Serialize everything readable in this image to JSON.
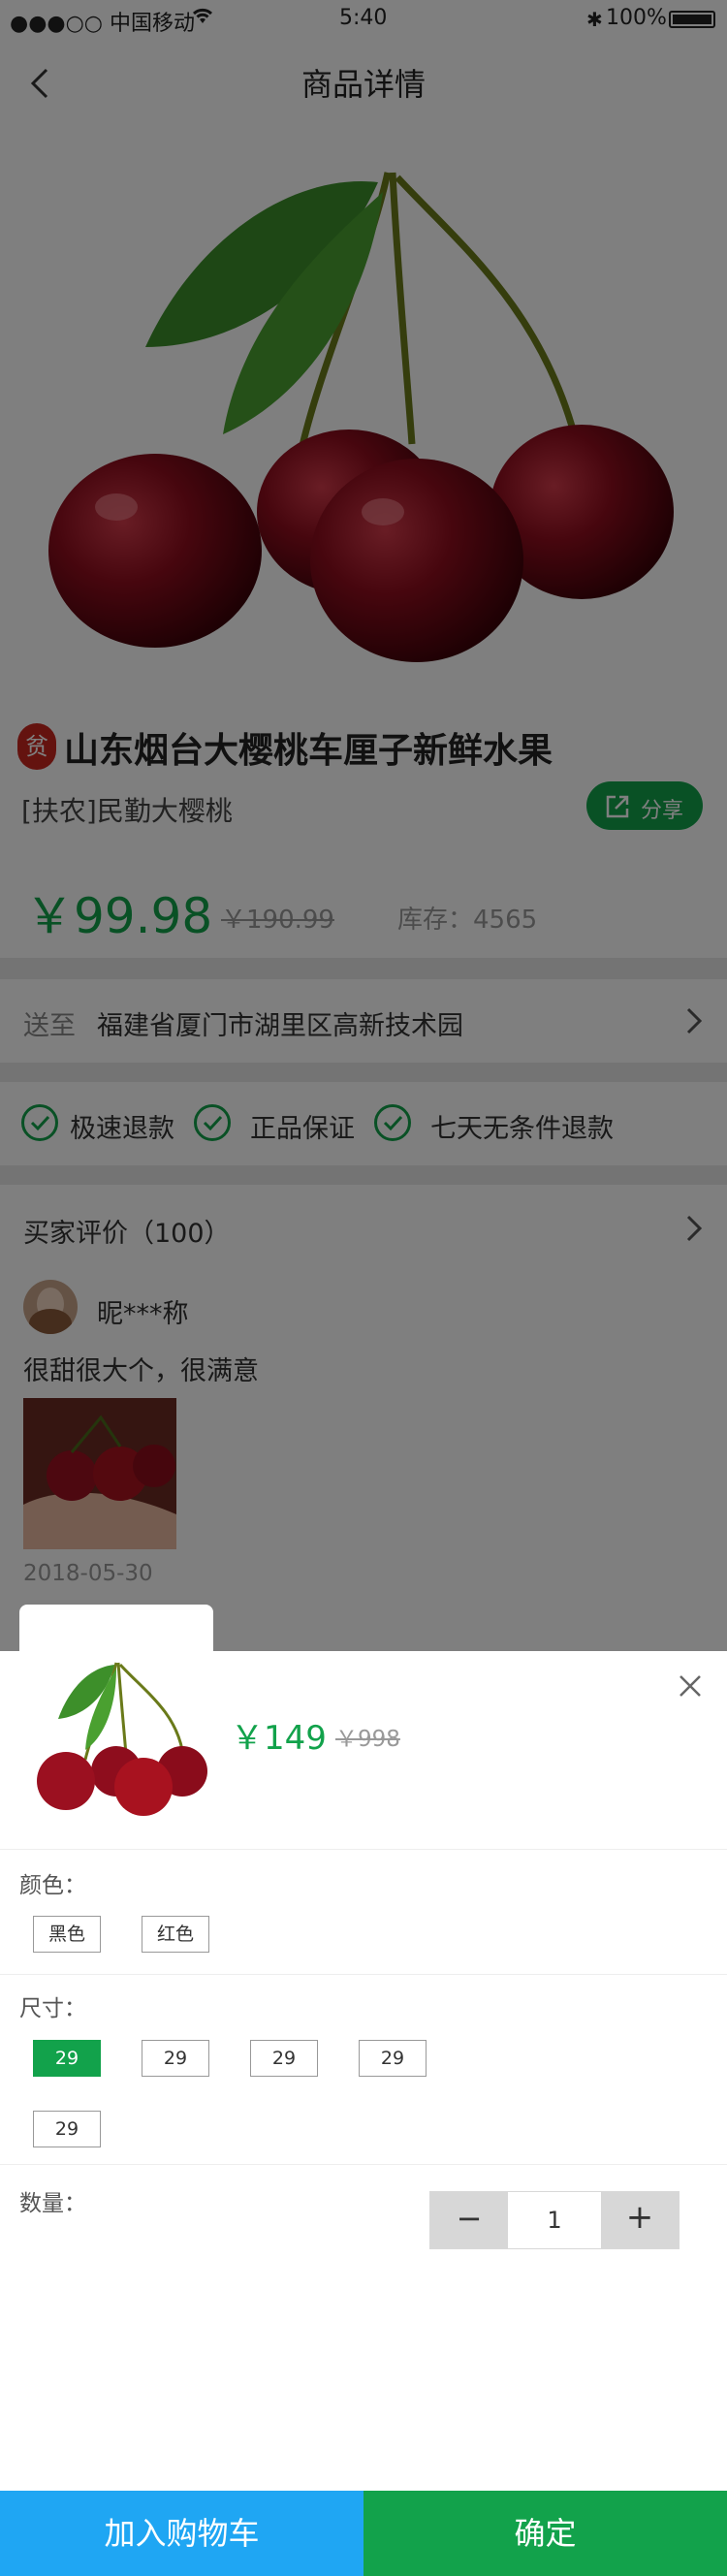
{
  "status_bar": {
    "carrier": "●●●○○ 中国移动",
    "time": "5:40",
    "battery": "100%"
  },
  "nav": {
    "title": "商品详情",
    "back_icon": "chevron-left-icon"
  },
  "product": {
    "title": "山东烟台大樱桃车厘子新鲜水果",
    "seal_text": "贫",
    "subtitle": "[扶农]民勤大樱桃",
    "share_label": "分享",
    "price": "￥99.98",
    "old_price": "￥190.99",
    "stock": "库存：4565"
  },
  "delivery": {
    "label": "送至",
    "address": "福建省厦门市湖里区高新技术园"
  },
  "guarantees": [
    "极速退款",
    "正品保证",
    "七天无条件退款"
  ],
  "reviews": {
    "header": "买家评价（100）",
    "user": "昵***称",
    "text": "很甜很大个，很满意",
    "date": "2018-05-30"
  },
  "sheet": {
    "price": "￥149",
    "old_price": "￥998",
    "color_label": "颜色：",
    "colors": [
      "黑色",
      "红色"
    ],
    "size_label": "尺寸：",
    "sizes": [
      "29",
      "29",
      "29",
      "29",
      "29"
    ],
    "selected_size_index": 0,
    "qty_label": "数量：",
    "qty": "1",
    "minus": "−",
    "plus": "+"
  },
  "footer": {
    "add_cart": "加入购物车",
    "confirm": "确定",
    "add_cart_color": "#1fa6f3",
    "confirm_color": "#12a24b"
  },
  "accent_color": "#12a24b"
}
